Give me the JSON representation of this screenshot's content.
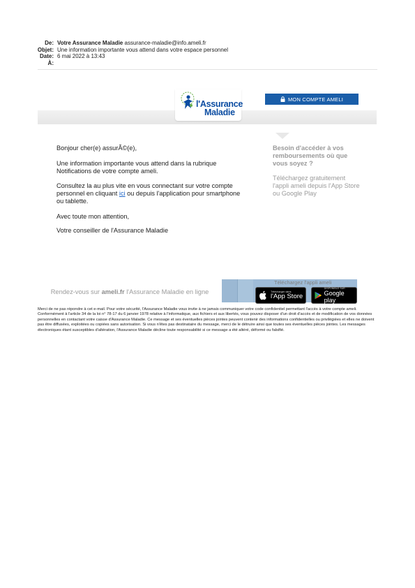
{
  "email": {
    "from_label": "De:",
    "from_name": "Votre Assurance Maladie",
    "from_address": "assurance-maladie@info.ameli.fr",
    "subject_label": "Objet:",
    "subject": "Une information importante vous attend dans votre espace personnel",
    "date_label": "Date:",
    "date": "6 mai 2022 à 13:43",
    "to_label": "À:",
    "to": ""
  },
  "banner": {
    "logo_line1": "l'Assurance",
    "logo_line2": "Maladie",
    "compte_button": "MON COMPTE  AMELI",
    "colors": {
      "brand_blue": "#0c4da2",
      "button_blue": "#1a5ea9",
      "logo_green": "#6ab04c"
    }
  },
  "body": {
    "greeting": "Bonjour cher(e) assurÃ©(e),",
    "p1": "Une information importante vous attend dans la rubrique Notifications de votre compte ameli.",
    "p2_before": "Consultez la au plus vite en vous connectant sur votre compte personnel en cliquant ",
    "p2_link": "ici",
    "p2_after": " ou depuis l'application pour smartphone ou tablette.",
    "closing": "Avec toute mon attention,",
    "signature": "Votre conseiller de l'Assurance Maladie"
  },
  "sidebar": {
    "title": "Besoin d'accéder à vos remboursements où que vous soyez ?",
    "text": "Téléchargez gratuitement l'appli ameli depuis l'App Store ou Google Play"
  },
  "footer": {
    "visit_before": "Rendez-vous sur ",
    "visit_site": "ameli.fr",
    "visit_after": " l'Assurance Maladie en ligne",
    "download_label": "Téléchargez l'appli ameli",
    "appstore_small": "Télécharger dans",
    "appstore_big": "l'App Store",
    "googleplay_small": "DISPONIBLE SUR",
    "googleplay_big": "Google play"
  },
  "legal": "Merci de ne pas répondre à cet e-mail. Pour votre sécurité, l'Assurance Maladie vous invite à ne jamais communiquer votre code confidentiel permettant l'accès à votre compte ameli. Conformément à l'article 34 de la loi n° 78-17 du 6 janvier 1978 relative à l'informatique, aux fichiers et aux libertés, vous pouvez disposer d'un droit d'accès et de modification de vos données personnelles en contactant votre caisse d'Assurance Maladie. Ce message et ses éventuelles pièces jointes peuvent contenir des informations confidentielles ou privilégiées et elles ne doivent pas être diffusées, exploitées ou copiées sans autorisation. Si vous n'êtes pas destinataire du message, merci de le détruire ainsi que toutes ses éventuelles pièces jointes. Les messages électroniques étant susceptibles d'altération, l'Assurance Maladie décline toute responsabilité si ce message a été altéré, déformé ou falsifié."
}
